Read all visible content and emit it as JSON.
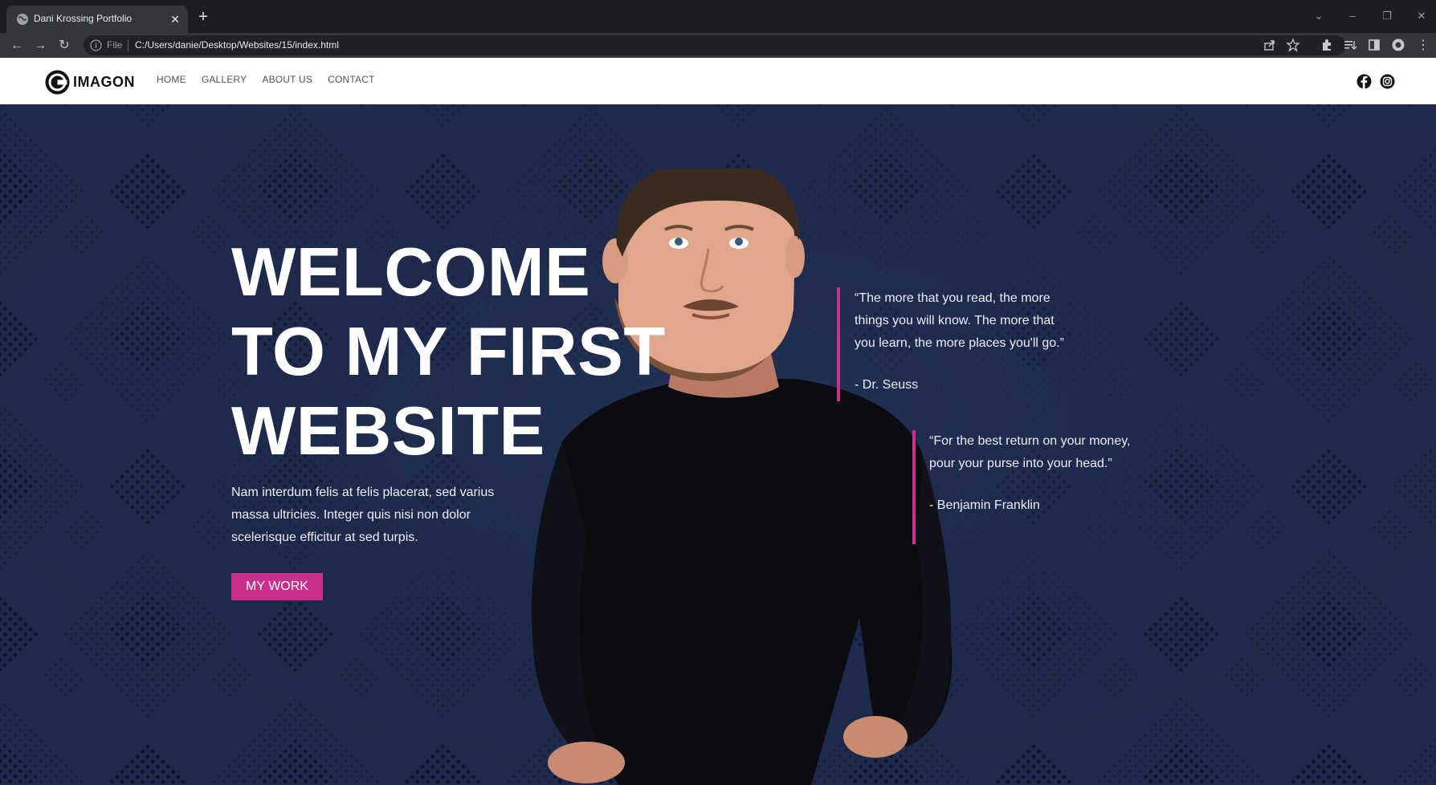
{
  "browser": {
    "tab_title": "Dani Krossing Portfolio",
    "url_scheme": "File",
    "url": "C:/Users/danie/Desktop/Websites/15/index.html"
  },
  "site": {
    "logo_text": "IMAGON",
    "nav": [
      "HOME",
      "GALLERY",
      "ABOUT US",
      "CONTACT"
    ],
    "social_icons": [
      "facebook-icon",
      "instagram-icon"
    ]
  },
  "hero": {
    "title_lines": [
      "WELCOME",
      "TO MY FIRST",
      "WEBSITE"
    ],
    "text": "Nam interdum felis at felis placerat, sed varius massa ultricies. Integer quis nisi non dolor scelerisque efficitur at sed turpis.",
    "button_label": "MY WORK"
  },
  "quotes": [
    {
      "text": "“The more that you read, the more things you will know. The more that you learn, the more places you'll go.”",
      "author": "- Dr. Seuss"
    },
    {
      "text": "“For the best return on your money, pour your purse into your head.”",
      "author": "- Benjamin Franklin"
    }
  ],
  "colors": {
    "accent": "#cb2f8e",
    "hero_bg": "#1d2a4b",
    "header_bg": "#ffffff"
  }
}
